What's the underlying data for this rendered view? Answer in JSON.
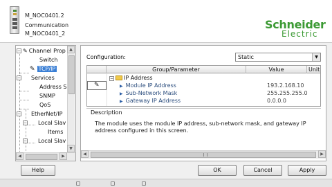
{
  "header": {
    "module_name": "M_NOC0401.2",
    "module_type": "Communication",
    "module_alias": "M_NOC0401_2",
    "brand_name": "Schneider",
    "brand_sub": "Electric"
  },
  "tree": {
    "items": [
      {
        "label": "Channel Prop",
        "expander": "−"
      },
      {
        "label": "Switch",
        "expander": ""
      },
      {
        "label": "TCP/IP",
        "expander": "",
        "selected": true
      },
      {
        "label": "Services",
        "expander": "−"
      },
      {
        "label": "Address S",
        "expander": ""
      },
      {
        "label": "SNMP",
        "expander": ""
      },
      {
        "label": "QoS",
        "expander": ""
      },
      {
        "label": "EtherNet/IP",
        "expander": "−"
      },
      {
        "label": "Local Slav",
        "expander": "−"
      },
      {
        "label": "Items",
        "expander": ""
      },
      {
        "label": "Local Slav",
        "expander": "−"
      }
    ]
  },
  "config": {
    "label": "Configuration:",
    "selected": "Static"
  },
  "grid": {
    "columns": [
      "Group/Parameter",
      "Value",
      "Unit"
    ],
    "group": {
      "expander": "−",
      "label": "IP Address"
    },
    "rows": [
      {
        "name": "Module IP Address",
        "value": "193.2.168.10"
      },
      {
        "name": "Sub-Network Mask",
        "value": "255.255.255.0"
      },
      {
        "name": "Gateway IP Address",
        "value": "0.0.0.0"
      }
    ]
  },
  "description": {
    "title": "Description",
    "text": "The module uses the module IP address, sub-network mask, and gateway IP address configured in this screen."
  },
  "buttons": {
    "help": "Help",
    "ok": "OK",
    "cancel": "Cancel",
    "apply": "Apply"
  },
  "icons": {
    "edit": "pencil-icon",
    "arrow_right": "triangle-right-icon",
    "folder": "folder-icon"
  },
  "colors": {
    "brand_green": "#3c9a34",
    "selection": "#3a7fd5"
  }
}
